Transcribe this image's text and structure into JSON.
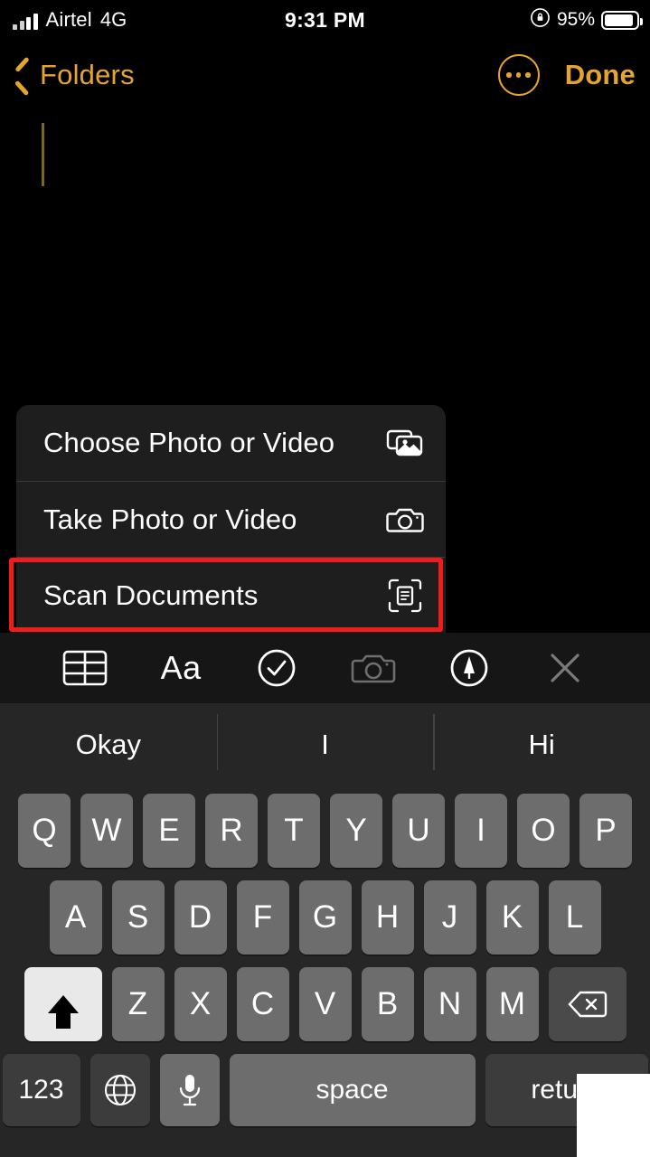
{
  "status_bar": {
    "carrier": "Airtel",
    "network": "4G",
    "time": "9:31 PM",
    "battery_percent": "95%",
    "signal_icon": "signal-bars-icon",
    "orientation_lock_icon": "rotation-lock-icon",
    "battery_icon": "battery-icon"
  },
  "nav_bar": {
    "back_label": "Folders",
    "back_icon": "chevron-left-icon",
    "more_icon": "ellipsis-circle-icon",
    "done_label": "Done"
  },
  "note": {
    "body_text": "",
    "caret_visible": true
  },
  "attachment_menu": {
    "items": [
      {
        "label": "Choose Photo or Video",
        "icon": "photo-stack-icon"
      },
      {
        "label": "Take Photo or Video",
        "icon": "camera-icon"
      },
      {
        "label": "Scan Documents",
        "icon": "document-scanner-icon"
      }
    ],
    "highlighted_item": "Scan Documents",
    "highlight_color": "#f01b1b"
  },
  "format_toolbar": {
    "buttons": [
      {
        "name": "table-icon",
        "label": ""
      },
      {
        "name": "text-format-icon",
        "label": "Aa"
      },
      {
        "name": "checklist-icon",
        "label": ""
      },
      {
        "name": "camera-icon",
        "label": ""
      },
      {
        "name": "markup-pen-icon",
        "label": ""
      },
      {
        "name": "close-icon",
        "label": ""
      }
    ]
  },
  "predictive_bar": {
    "suggestions": [
      "Okay",
      "I",
      "Hi"
    ]
  },
  "keyboard": {
    "row1": [
      "Q",
      "W",
      "E",
      "R",
      "T",
      "Y",
      "U",
      "I",
      "O",
      "P"
    ],
    "row2": [
      "A",
      "S",
      "D",
      "F",
      "G",
      "H",
      "J",
      "K",
      "L"
    ],
    "row3": [
      "Z",
      "X",
      "C",
      "V",
      "B",
      "N",
      "M"
    ],
    "shift_icon": "shift-up-arrow-icon",
    "delete_icon": "backspace-icon",
    "numbers_label": "123",
    "globe_icon": "globe-icon",
    "mic_icon": "microphone-icon",
    "space_label": "space",
    "return_label": "return"
  },
  "colors": {
    "accent": "#E6A42B",
    "menu_background": "#1e1e1e",
    "keyboard_background": "#262626",
    "key_background": "#6d6d6d",
    "highlight": "#f01b1b"
  }
}
